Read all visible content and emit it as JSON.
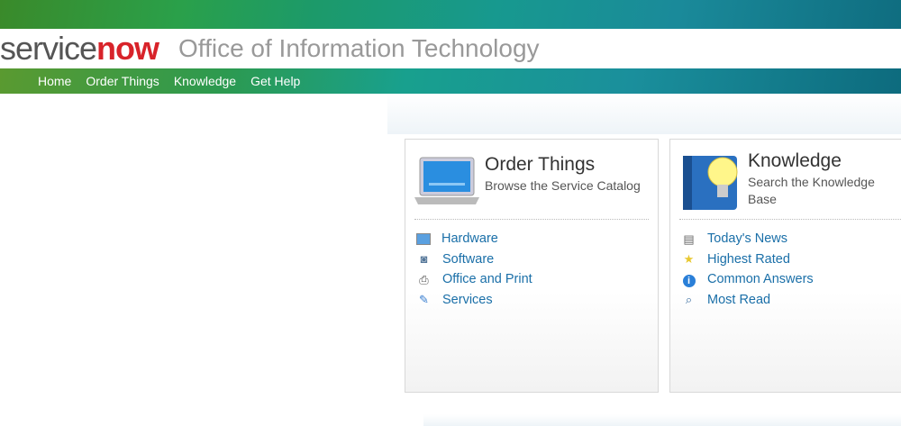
{
  "header": {
    "logo_part1": "service",
    "logo_part2": "now",
    "org_title": "Office of Information Technology"
  },
  "nav": [
    {
      "label": "Home"
    },
    {
      "label": "Order Things"
    },
    {
      "label": "Knowledge"
    },
    {
      "label": "Get Help"
    }
  ],
  "order": {
    "title": "Order Things",
    "subtitle": "Browse the Service Catalog",
    "icon": "laptop-icon",
    "items": [
      {
        "label": "Hardware",
        "icon": "monitor-icon"
      },
      {
        "label": "Software",
        "icon": "software-cd-icon"
      },
      {
        "label": "Office and Print",
        "icon": "printer-icon"
      },
      {
        "label": "Services",
        "icon": "tools-icon"
      }
    ]
  },
  "knowledge": {
    "title": "Knowledge",
    "subtitle": "Search the Knowledge Base",
    "icon": "book-lightbulb-icon",
    "items": [
      {
        "label": "Today's News",
        "icon": "newspaper-icon"
      },
      {
        "label": "Highest Rated",
        "icon": "star-icon"
      },
      {
        "label": "Common Answers",
        "icon": "info-icon"
      },
      {
        "label": "Most Read",
        "icon": "magnifier-icon"
      }
    ]
  }
}
